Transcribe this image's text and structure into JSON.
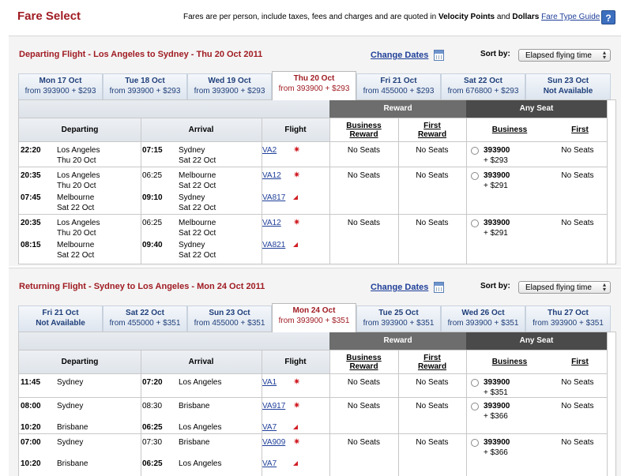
{
  "header": {
    "title": "Fare Select",
    "note_text": "Fares are per person, include taxes, fees and charges and are quoted in",
    "note_bold1": "Velocity Points",
    "note_and": "and",
    "note_bold2": "Dollars",
    "guide_link": "Fare Type Guide",
    "help": "?"
  },
  "common": {
    "change_dates": "Change Dates",
    "sort_label": "Sort by:",
    "sort_value": "Elapsed flying time",
    "reward": "Reward",
    "any_seat": "Any Seat",
    "col_departing": "Departing",
    "col_arrival": "Arrival",
    "col_flight": "Flight",
    "col_business_reward_1": "Business",
    "col_business_reward_2": "Reward",
    "col_first_reward_1": "First",
    "col_first_reward_2": "Reward",
    "col_business": "Business",
    "col_first": "First",
    "no_seats": "No Seats"
  },
  "departing": {
    "title": "Departing Flight - Los Angeles to Sydney - Thu 20 Oct 2011",
    "tabs": [
      {
        "date": "Mon 17 Oct",
        "price": "from 393900 + $293"
      },
      {
        "date": "Tue 18 Oct",
        "price": "from 393900 + $293"
      },
      {
        "date": "Wed 19 Oct",
        "price": "from 393900 + $293"
      },
      {
        "date": "Thu 20 Oct",
        "price": "from 393900 + $293"
      },
      {
        "date": "Fri 21 Oct",
        "price": "from 455000 + $293"
      },
      {
        "date": "Sat 22 Oct",
        "price": "from 676800 + $293"
      },
      {
        "date": "Sun 23 Oct",
        "price": "Not Available"
      }
    ],
    "rows": [
      {
        "legs": [
          {
            "dep_time": "22:20",
            "dep_city": "Los Angeles",
            "dep_date": "Thu 20 Oct",
            "arr_time": "07:15",
            "arr_city": "Sydney",
            "arr_date": "Sat 22 Oct",
            "flight": "VA2"
          }
        ],
        "biz_reward": "No Seats",
        "first_reward": "No Seats",
        "points": "393900",
        "dollars": "+ $293",
        "first": "No Seats"
      },
      {
        "legs": [
          {
            "dep_time": "20:35",
            "dep_city": "Los Angeles",
            "dep_date": "Thu 20 Oct",
            "arr_time": "06:25",
            "arr_city": "Melbourne",
            "arr_date": "Sat 22 Oct",
            "flight": "VA12"
          },
          {
            "dep_time": "07:45",
            "dep_city": "Melbourne",
            "dep_date": "Sat 22 Oct",
            "arr_time": "09:10",
            "arr_city": "Sydney",
            "arr_date": "Sat 22 Oct",
            "flight": "VA817"
          }
        ],
        "biz_reward": "No Seats",
        "first_reward": "No Seats",
        "points": "393900",
        "dollars": "+ $291",
        "first": "No Seats"
      },
      {
        "legs": [
          {
            "dep_time": "20:35",
            "dep_city": "Los Angeles",
            "dep_date": "Thu 20 Oct",
            "arr_time": "06:25",
            "arr_city": "Melbourne",
            "arr_date": "Sat 22 Oct",
            "flight": "VA12"
          },
          {
            "dep_time": "08:15",
            "dep_city": "Melbourne",
            "dep_date": "Sat 22 Oct",
            "arr_time": "09:40",
            "arr_city": "Sydney",
            "arr_date": "Sat 22 Oct",
            "flight": "VA821"
          }
        ],
        "biz_reward": "No Seats",
        "first_reward": "No Seats",
        "points": "393900",
        "dollars": "+ $291",
        "first": "No Seats"
      }
    ]
  },
  "returning": {
    "title": "Returning Flight - Sydney to Los Angeles - Mon 24 Oct 2011",
    "tabs": [
      {
        "date": "Fri 21 Oct",
        "price": "Not Available"
      },
      {
        "date": "Sat 22 Oct",
        "price": "from 455000 + $351"
      },
      {
        "date": "Sun 23 Oct",
        "price": "from 455000 + $351"
      },
      {
        "date": "Mon 24 Oct",
        "price": "from 393900 + $351"
      },
      {
        "date": "Tue 25 Oct",
        "price": "from 393900 + $351"
      },
      {
        "date": "Wed 26 Oct",
        "price": "from 393900 + $351"
      },
      {
        "date": "Thu 27 Oct",
        "price": "from 393900 + $351"
      }
    ],
    "rows": [
      {
        "legs": [
          {
            "dep_time": "11:45",
            "dep_city": "Sydney",
            "dep_date": "",
            "arr_time": "07:20",
            "arr_city": "Los Angeles",
            "arr_date": "",
            "flight": "VA1"
          }
        ],
        "biz_reward": "No Seats",
        "first_reward": "No Seats",
        "points": "393900",
        "dollars": "+ $351",
        "first": "No Seats"
      },
      {
        "legs": [
          {
            "dep_time": "08:00",
            "dep_city": "Sydney",
            "dep_date": "",
            "arr_time": "08:30",
            "arr_city": "Brisbane",
            "arr_date": "",
            "flight": "VA917"
          },
          {
            "dep_time": "10:20",
            "dep_city": "Brisbane",
            "dep_date": "",
            "arr_time": "06:25",
            "arr_city": "Los Angeles",
            "arr_date": "",
            "flight": "VA7"
          }
        ],
        "biz_reward": "No Seats",
        "first_reward": "No Seats",
        "points": "393900",
        "dollars": "+ $366",
        "first": "No Seats"
      },
      {
        "legs": [
          {
            "dep_time": "07:00",
            "dep_city": "Sydney",
            "dep_date": "",
            "arr_time": "07:30",
            "arr_city": "Brisbane",
            "arr_date": "",
            "flight": "VA909"
          },
          {
            "dep_time": "10:20",
            "dep_city": "Brisbane",
            "dep_date": "",
            "arr_time": "06:25",
            "arr_city": "Los Angeles",
            "arr_date": "",
            "flight": "VA7"
          }
        ],
        "biz_reward": "No Seats",
        "first_reward": "No Seats",
        "points": "393900",
        "dollars": "+ $366",
        "first": "No Seats"
      }
    ]
  }
}
